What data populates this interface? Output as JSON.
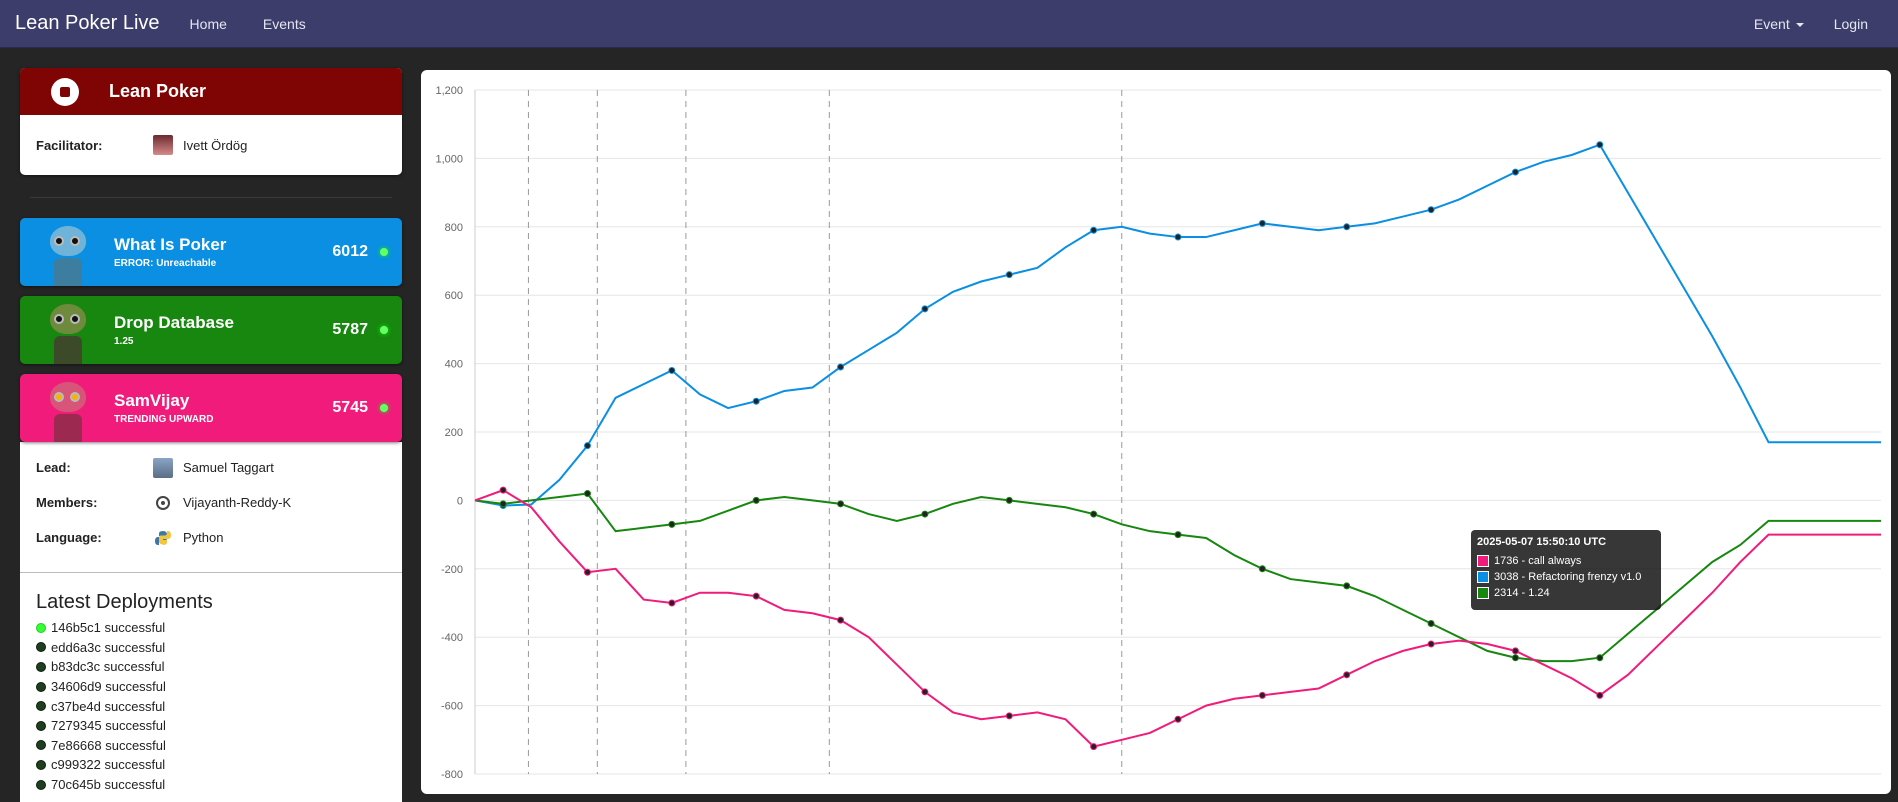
{
  "nav": {
    "brand": "Lean Poker Live",
    "home": "Home",
    "events": "Events",
    "event_menu": "Event",
    "login": "Login"
  },
  "event": {
    "title": "Lean Poker",
    "facilitator_label": "Facilitator:",
    "facilitator_name": "Ivett Ördög"
  },
  "teams": [
    {
      "name": "What Is Poker",
      "subtitle": "ERROR: Unreachable",
      "score": "6012",
      "color": "#0a8fe2"
    },
    {
      "name": "Drop Database",
      "subtitle": "1.25",
      "score": "5787",
      "color": "#17870f"
    },
    {
      "name": "SamVijay",
      "subtitle": "TRENDING UPWARD",
      "score": "5745",
      "color": "#f01b7b"
    }
  ],
  "team_details": {
    "lead_label": "Lead:",
    "lead": "Samuel Taggart",
    "members_label": "Members:",
    "members": "Vijayanth-Reddy-K",
    "language_label": "Language:",
    "language": "Python"
  },
  "deployments": {
    "title": "Latest Deployments",
    "items": [
      "146b5c1 successful",
      "edd6a3c successful",
      "b83dc3c successful",
      "34606d9 successful",
      "c37be4d successful",
      "7279345 successful",
      "7e86668 successful",
      "c999322 successful",
      "70c645b successful"
    ]
  },
  "tooltip": {
    "title": "2025-05-07 15:50:10 UTC",
    "rows": [
      {
        "text": "1736 - call always",
        "color": "#f01b7b"
      },
      {
        "text": "3038 - Refactoring frenzy v1.0",
        "color": "#0a8fe2"
      },
      {
        "text": "2314 - 1.24",
        "color": "#17870f"
      }
    ]
  },
  "chart_data": {
    "type": "line",
    "ylim": [
      -800,
      1200
    ],
    "yticks": [
      -800,
      -600,
      -400,
      -200,
      0,
      200,
      400,
      600,
      800,
      1000,
      1200
    ],
    "ytick_labels": [
      "-800",
      "-600",
      "-400",
      "-200",
      "0",
      "200",
      "400",
      "600",
      "800",
      "1,000",
      "1,200"
    ],
    "grid": true,
    "x": [
      0,
      2,
      4,
      6,
      8,
      10,
      12,
      14,
      16,
      18,
      20,
      22,
      24,
      26,
      28,
      30,
      32,
      34,
      36,
      38,
      40,
      42,
      44,
      46,
      48,
      50,
      52,
      54,
      56,
      58,
      60,
      62,
      64,
      66,
      68,
      70,
      72,
      74,
      76,
      78,
      80,
      82,
      84,
      86,
      88,
      90,
      92,
      94,
      96,
      98,
      100
    ],
    "vlines": [
      3.8,
      8.7,
      15.0,
      25.2,
      46.0
    ],
    "series": [
      {
        "color": "#0a8fe2",
        "values": [
          0,
          -15,
          -12,
          60,
          160,
          300,
          340,
          380,
          310,
          270,
          290,
          320,
          330,
          390,
          440,
          490,
          560,
          610,
          640,
          660,
          680,
          740,
          790,
          800,
          780,
          770,
          770,
          790,
          810,
          800,
          790,
          800,
          810,
          830,
          850,
          880,
          920,
          960,
          990,
          1010,
          1040,
          900,
          760,
          620,
          480,
          330,
          170,
          170,
          170,
          170,
          170
        ]
      },
      {
        "color": "#17870f",
        "values": [
          0,
          -10,
          0,
          10,
          20,
          -90,
          -80,
          -70,
          -60,
          -30,
          0,
          10,
          0,
          -10,
          -40,
          -60,
          -40,
          -10,
          10,
          0,
          -10,
          -20,
          -40,
          -70,
          -90,
          -100,
          -110,
          -160,
          -200,
          -230,
          -240,
          -250,
          -280,
          -320,
          -360,
          -400,
          -440,
          -460,
          -470,
          -470,
          -460,
          -390,
          -320,
          -250,
          -180,
          -130,
          -60,
          -60,
          -60,
          -60,
          -60
        ]
      },
      {
        "color": "#f01b7b",
        "values": [
          0,
          30,
          -20,
          -120,
          -210,
          -200,
          -290,
          -300,
          -270,
          -270,
          -280,
          -320,
          -330,
          -350,
          -400,
          -480,
          -560,
          -620,
          -640,
          -630,
          -620,
          -640,
          -720,
          -700,
          -680,
          -640,
          -600,
          -580,
          -570,
          -560,
          -550,
          -510,
          -470,
          -440,
          -420,
          -410,
          -420,
          -440,
          -480,
          -520,
          -570,
          -510,
          -430,
          -350,
          -270,
          -180,
          -100,
          -100,
          -100,
          -100,
          -100
        ]
      }
    ]
  }
}
